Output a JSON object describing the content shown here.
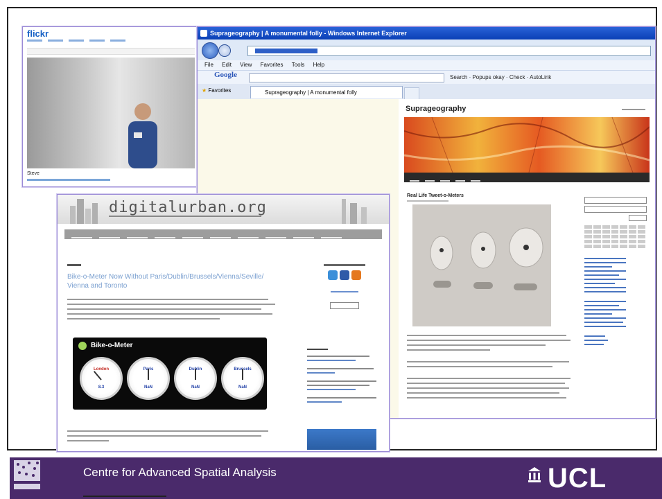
{
  "flickr": {
    "logo": "flickr",
    "caption": "Steve"
  },
  "ie": {
    "window_title": "Suprageography | A monumental folly - Windows Internet Explorer",
    "menu": [
      "File",
      "Edit",
      "View",
      "Favorites",
      "Tools",
      "Help"
    ],
    "google_label": "Google",
    "toolbar_tools": "Search  ·  Popups okay  ·  Check  ·  AutoLink",
    "favorites_label": "Favorites",
    "tab_label": "Suprageography | A monumental folly"
  },
  "blog": {
    "site_title": "Suprageography",
    "post_title": "Real Life Tweet-o-Meters"
  },
  "digitalurban": {
    "title": "digitalurban.org",
    "post_title": "Bike-o-Meter Now Without Paris/Dublin/Brussels/Vienna/Seville/ Vienna and Toronto",
    "widget": {
      "title": "Bike-o-Meter",
      "dials": [
        {
          "city": "London",
          "value": "8.3",
          "color": "#c1261e"
        },
        {
          "city": "Paris",
          "value": "NaN",
          "color": "#1f3fa6"
        },
        {
          "city": "Dublin",
          "value": "NaN",
          "color": "#1f3fa6"
        },
        {
          "city": "Brussels",
          "value": "NaN",
          "color": "#1f3fa6"
        }
      ]
    }
  },
  "footer": {
    "centre_name": "Centre for Advanced Spatial Analysis",
    "ucl_logo": "UCL",
    "colors": {
      "band": "#4a2a6b"
    }
  }
}
